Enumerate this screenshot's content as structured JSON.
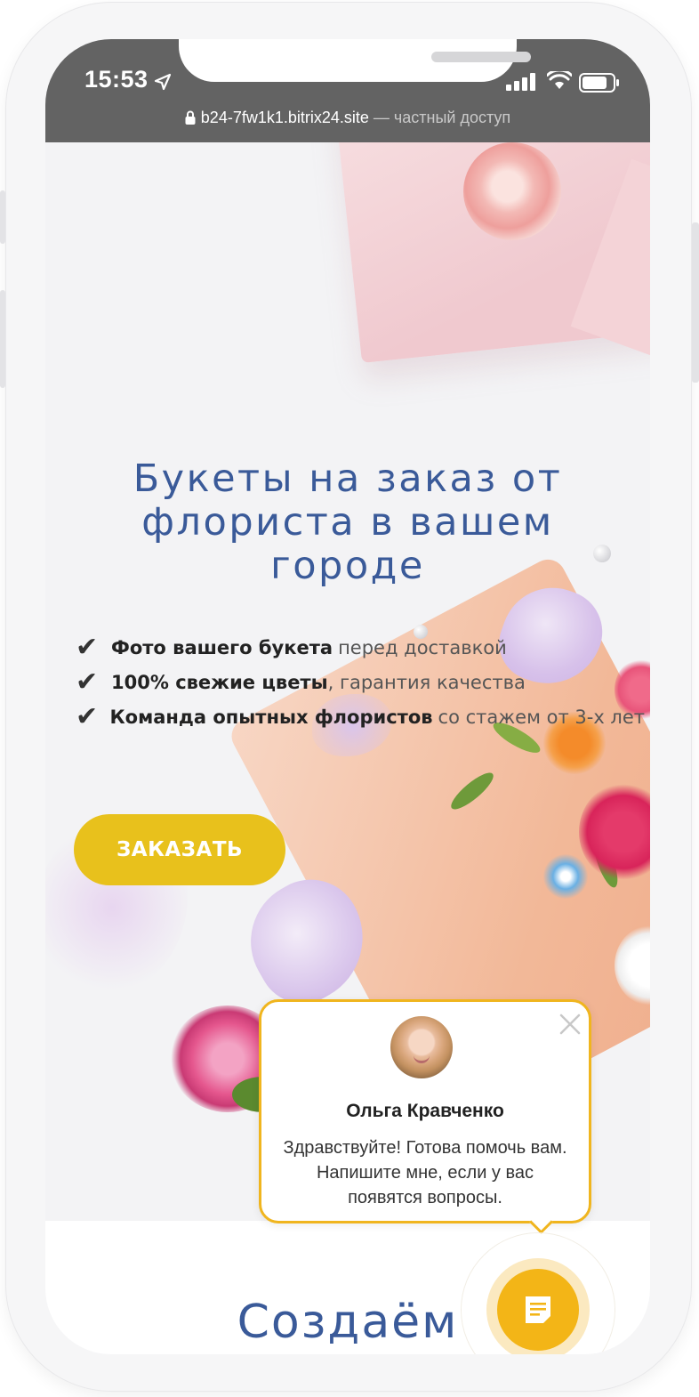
{
  "status_bar": {
    "time": "15:53",
    "domain": "b24-7fw1k1.bitrix24.site",
    "access_note": " — частный доступ",
    "icons": [
      "location-arrow-icon",
      "signal-icon",
      "wifi-icon",
      "battery-icon",
      "lock-icon"
    ]
  },
  "hero": {
    "title_line1": "Букеты на заказ от",
    "title_line2": "флориста в вашем",
    "title_line3": "городе",
    "features": [
      {
        "check": "✔",
        "bold": "Фото вашего букета",
        "rest": "перед доставкой"
      },
      {
        "check": "✔",
        "bold": "100% свежие цветы",
        "rest": ", гарантия качества"
      },
      {
        "check": "✔",
        "bold": "Команда опытных флористов",
        "rest": "со стажем от 3-х лет"
      }
    ],
    "order_button": "ЗАКАЗАТЬ"
  },
  "next_section": {
    "title": "Создаём"
  },
  "chat": {
    "agent_name": "Ольга Кравченко",
    "message": "Здравствуйте! Готова помочь вам. Напишите мне, если у вас появятся вопросы.",
    "close_icon": "close-icon",
    "button_icon": "chat-form-icon"
  },
  "colors": {
    "title_blue": "#3a5a99",
    "button_yellow": "#e8c11c",
    "chat_accent": "#f0b51e",
    "statusbar_gray": "#636363"
  }
}
